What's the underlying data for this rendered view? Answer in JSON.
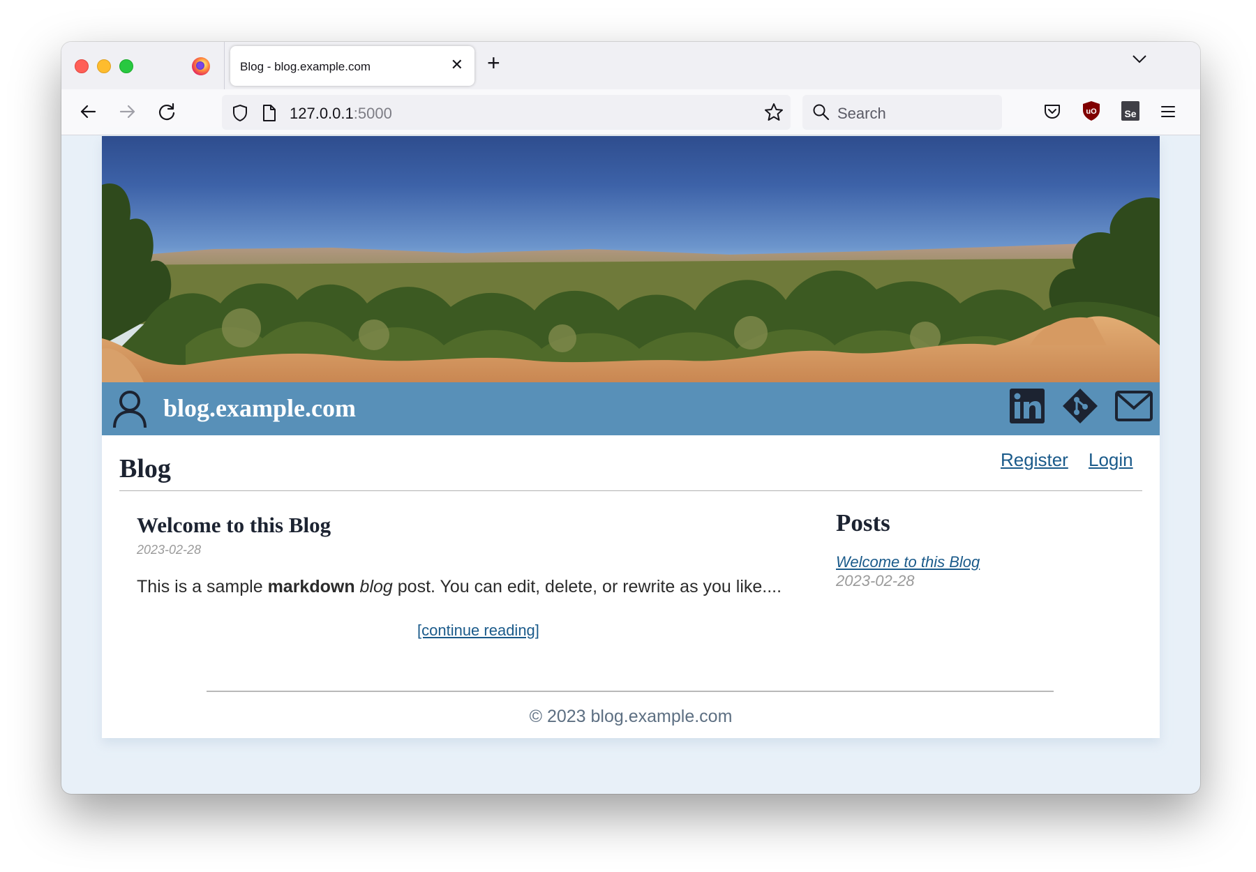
{
  "browser": {
    "tab_title": "Blog - blog.example.com",
    "tab_close": "✕",
    "new_tab": "+",
    "url_host": "127.0.0.1",
    "url_port": ":5000",
    "search_placeholder": "Search"
  },
  "site": {
    "title": "blog.example.com"
  },
  "main": {
    "heading": "Blog",
    "register_label": "Register",
    "login_label": "Login"
  },
  "post": {
    "title": "Welcome to this Blog",
    "date": "2023-02-28",
    "excerpt_before": "This is a sample ",
    "excerpt_bold": "markdown",
    "excerpt_space": " ",
    "excerpt_italic": "blog",
    "excerpt_after": " post. You can edit, delete, or rewrite as you like....",
    "continue_label": "[continue reading]"
  },
  "sidebar": {
    "title": "Posts",
    "items": [
      {
        "label": "Welcome to this Blog",
        "date": "2023-02-28"
      }
    ]
  },
  "footer": {
    "text": "© 2023 blog.example.com"
  },
  "icons": {
    "tab_strip": [
      "firefox-icon",
      "chevron-down-icon"
    ],
    "nav_bar": [
      "back-arrow-icon",
      "forward-arrow-icon",
      "reload-icon",
      "shield-icon",
      "page-icon",
      "bookmark-star-icon",
      "search-icon",
      "pocket-icon",
      "ublock-origin-icon",
      "selenium-icon",
      "hamburger-menu-icon"
    ],
    "header": [
      "user-icon",
      "linkedin-icon",
      "git-icon",
      "mail-icon"
    ]
  },
  "colors": {
    "header_bar": "#5890b8",
    "link": "#1a5a8a",
    "muted_date": "#9a9a9a",
    "heading": "#1c2331",
    "window_background": "#e8f0f8"
  }
}
